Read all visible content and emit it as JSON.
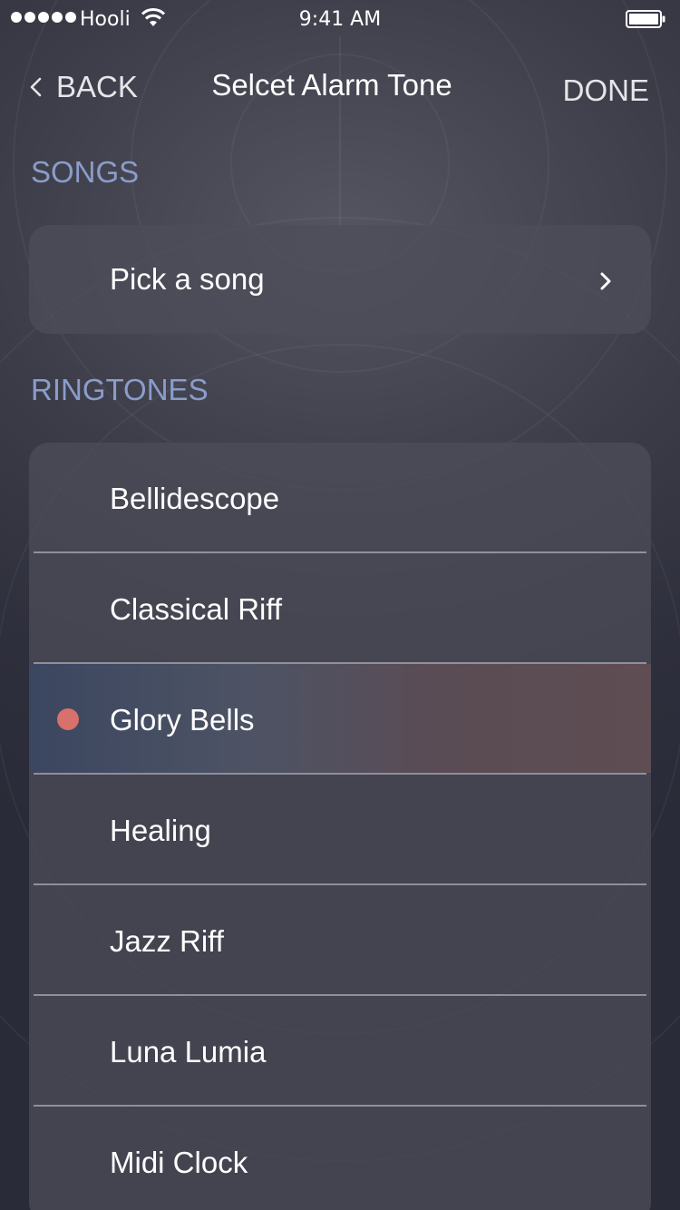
{
  "status_bar": {
    "carrier": "Hooli",
    "time": "9:41 AM"
  },
  "nav": {
    "back_label": "BACK",
    "title": "Selcet Alarm Tone",
    "done_label": "DONE"
  },
  "songs": {
    "header": "SONGS",
    "pick_label": "Pick a song"
  },
  "ringtones": {
    "header": "RINGTONES",
    "items": [
      {
        "label": "Bellidescope"
      },
      {
        "label": "Classical Riff"
      },
      {
        "label": "Glory Bells"
      },
      {
        "label": "Healing"
      },
      {
        "label": "Jazz Riff"
      },
      {
        "label": "Luna Lumia"
      },
      {
        "label": "Midi Clock"
      }
    ],
    "selected": "Glory Bells"
  },
  "colors": {
    "section_header": "#8a9dcb",
    "selected_dot": "#d8706d"
  },
  "icons": {
    "back": "chevron-left-icon",
    "forward": "chevron-right-icon",
    "wifi": "wifi-icon",
    "battery": "battery-icon"
  }
}
